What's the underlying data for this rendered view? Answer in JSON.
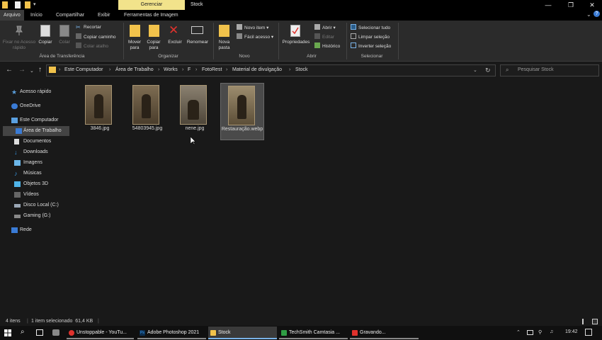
{
  "window": {
    "contextual_tab": "Gerenciar",
    "title": "Stock"
  },
  "ribbon_tabs": [
    "Arquivo",
    "Início",
    "Compartilhar",
    "Exibir",
    "Ferramentas de Imagem"
  ],
  "ribbon": {
    "clipboard": {
      "pin": "Fixar no Acesso rápido",
      "copy": "Copiar",
      "paste": "Colar",
      "cut": "Recortar",
      "copy_path": "Copiar caminho",
      "paste_shortcut": "Colar atalho",
      "label": "Área de Transferência"
    },
    "organize": {
      "move_to": "Mover para",
      "copy_to": "Copiar para",
      "delete": "Excluir",
      "rename": "Renomear",
      "label": "Organizar"
    },
    "new": {
      "new_folder": "Nova pasta",
      "new_item": "Novo item",
      "easy_access": "Fácil acesso",
      "label": "Novo"
    },
    "open": {
      "properties": "Propriedades",
      "open": "Abrir",
      "edit": "Editar",
      "history": "Histórico",
      "label": "Abrir"
    },
    "select": {
      "select_all": "Selecionar tudo",
      "select_none": "Limpar seleção",
      "invert": "Inverter seleção",
      "label": "Selecionar"
    }
  },
  "address": {
    "crumbs": [
      "Este Computador",
      "Área de Trabalho",
      "Works",
      "F",
      "FotoRest",
      "Material de divulgação",
      "Stock"
    ],
    "search_placeholder": "Pesquisar Stock"
  },
  "nav_pane": {
    "quick_access": "Acesso rápido",
    "onedrive": "OneDrive",
    "this_pc": "Este Computador",
    "desktop": "Área de Trabalho",
    "documents": "Documentos",
    "downloads": "Downloads",
    "images": "Imagens",
    "music": "Músicas",
    "objects3d": "Objetos 3D",
    "videos": "Vídeos",
    "local_disk": "Disco Local (C:)",
    "gaming": "Gaming (G:)",
    "network": "Rede"
  },
  "files": [
    {
      "name": "3846.jpg"
    },
    {
      "name": "54803945.jpg"
    },
    {
      "name": "nene.jpg"
    },
    {
      "name": "Restauração.webp"
    }
  ],
  "status": {
    "count": "4 itens",
    "selection": "1 item selecionado  61,4 KB"
  },
  "taskbar": {
    "items": [
      "Unstoppable - YouTu...",
      "Adobe Photoshop 2021",
      "Stock",
      "TechSmith Camtasia ...",
      "Gravando..."
    ],
    "clock": "19:42"
  },
  "colors": {
    "contextual_tab": "#f2e38b",
    "folder": "#f1c24b",
    "accent": "#7ab3e8",
    "delete_red": "#e0322d"
  }
}
